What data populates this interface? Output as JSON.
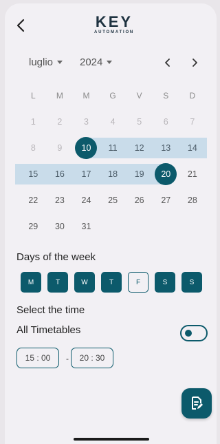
{
  "header": {
    "logo_main": "KEY",
    "logo_sub": "AUTOMATION"
  },
  "calendar": {
    "month": "luglio",
    "year": "2024",
    "weekdays": [
      "L",
      "M",
      "M",
      "G",
      "V",
      "S",
      "D"
    ],
    "weeks": [
      [
        "1",
        "2",
        "3",
        "4",
        "5",
        "6",
        "7"
      ],
      [
        "8",
        "9",
        "10",
        "11",
        "12",
        "13",
        "14"
      ],
      [
        "15",
        "16",
        "17",
        "18",
        "19",
        "20",
        "21"
      ],
      [
        "22",
        "23",
        "24",
        "25",
        "26",
        "27",
        "28"
      ],
      [
        "29",
        "30",
        "31",
        "",
        "",
        "",
        ""
      ]
    ],
    "range_start": "10",
    "range_end": "20"
  },
  "days_section": {
    "title": "Days of the week",
    "days": [
      {
        "label": "M",
        "selected": true
      },
      {
        "label": "T",
        "selected": true
      },
      {
        "label": "W",
        "selected": true
      },
      {
        "label": "T",
        "selected": true
      },
      {
        "label": "F",
        "selected": false
      },
      {
        "label": "S",
        "selected": true
      },
      {
        "label": "S",
        "selected": true
      }
    ]
  },
  "time_section": {
    "title": "Select the time",
    "all_timetables_label": "All Timetables",
    "all_timetables_on": false,
    "start_time": "15 : 00",
    "separator": "-",
    "end_time": "20 : 30"
  },
  "colors": {
    "accent": "#0c5a6b",
    "range": "#c9dcea",
    "background": "#f2f0f4"
  },
  "icons": {
    "back": "chevron-left-icon",
    "prev": "chevron-left-icon",
    "next": "chevron-right-icon",
    "fab": "edit-document-icon"
  }
}
